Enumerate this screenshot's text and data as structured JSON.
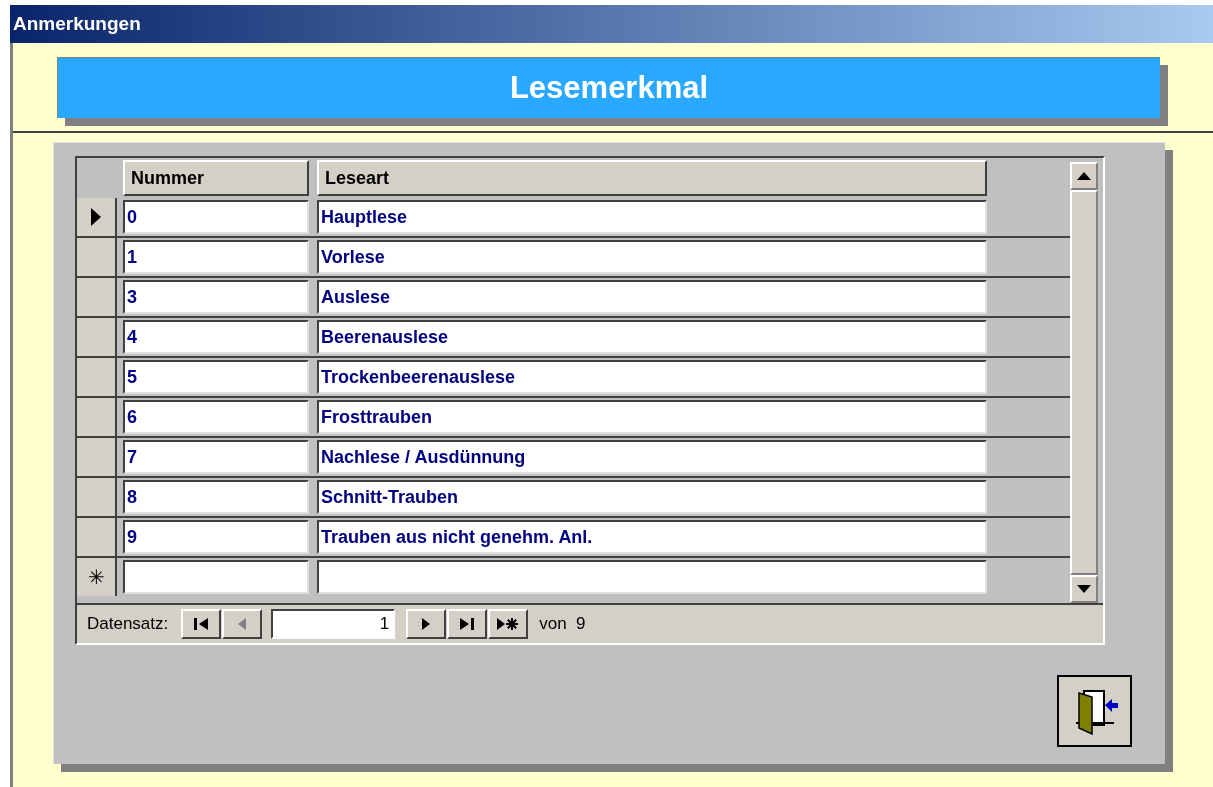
{
  "window": {
    "title": "Anmerkungen"
  },
  "banner": {
    "title": "Lesemerkmal"
  },
  "table": {
    "columns": [
      {
        "label": "Nummer"
      },
      {
        "label": "Leseart"
      }
    ],
    "rows": [
      {
        "nummer": "0",
        "leseart": "Hauptlese",
        "current": true
      },
      {
        "nummer": "1",
        "leseart": "Vorlese",
        "current": false
      },
      {
        "nummer": "3",
        "leseart": "Auslese",
        "current": false
      },
      {
        "nummer": "4",
        "leseart": "Beerenauslese",
        "current": false
      },
      {
        "nummer": "5",
        "leseart": "Trockenbeerenauslese",
        "current": false
      },
      {
        "nummer": "6",
        "leseart": "Frosttrauben",
        "current": false
      },
      {
        "nummer": "7",
        "leseart": "Nachlese / Ausdünnung",
        "current": false
      },
      {
        "nummer": "8",
        "leseart": "Schnitt-Trauben",
        "current": false
      },
      {
        "nummer": "9",
        "leseart": "Trauben aus nicht genehm. Anl.",
        "current": false
      }
    ],
    "new_row_marker": "✳"
  },
  "navigation": {
    "label": "Datensatz:",
    "record": "1",
    "total": "von  9",
    "buttons": [
      {
        "kind": "first",
        "disabled": false
      },
      {
        "kind": "prev",
        "disabled": true
      }
    ],
    "buttons_after": [
      {
        "kind": "next",
        "disabled": false
      },
      {
        "kind": "last",
        "disabled": false
      },
      {
        "kind": "new",
        "disabled": false
      }
    ]
  }
}
